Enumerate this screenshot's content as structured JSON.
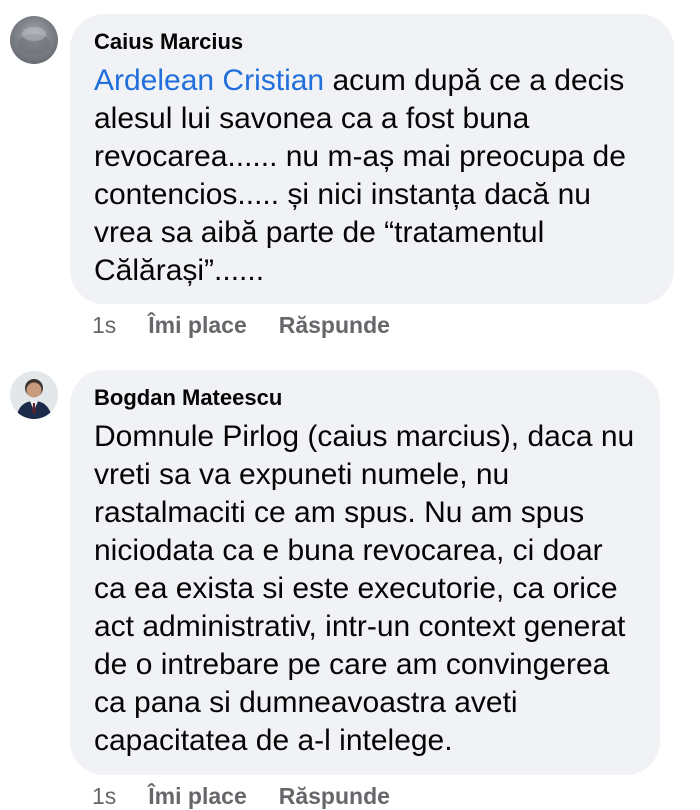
{
  "comments": [
    {
      "author": "Caius Marcius",
      "mention": "Ardelean Cristian",
      "text": " acum după ce a decis alesul lui savonea ca a fost buna revocarea...... nu m-aș mai preocupa de contencios..... și nici instanța dacă nu vrea sa aibă parte de “tratamentul Călărași”......",
      "time": "1s",
      "like_label": "Îmi place",
      "reply_label": "Răspunde"
    },
    {
      "author": "Bogdan Mateescu",
      "mention": "",
      "text": "Domnule Pirlog (caius marcius), daca nu vreti sa va expuneti numele, nu rastalmaciti ce am spus. Nu am spus niciodata ca e buna revocarea, ci doar ca ea exista si este executorie, ca orice act administrativ, intr-un context generat de o intrebare pe care am convingerea ca pana si dumneavoastra aveti capacitatea de a-l intelege.",
      "time": "1s",
      "like_label": "Îmi place",
      "reply_label": "Răspunde"
    }
  ]
}
